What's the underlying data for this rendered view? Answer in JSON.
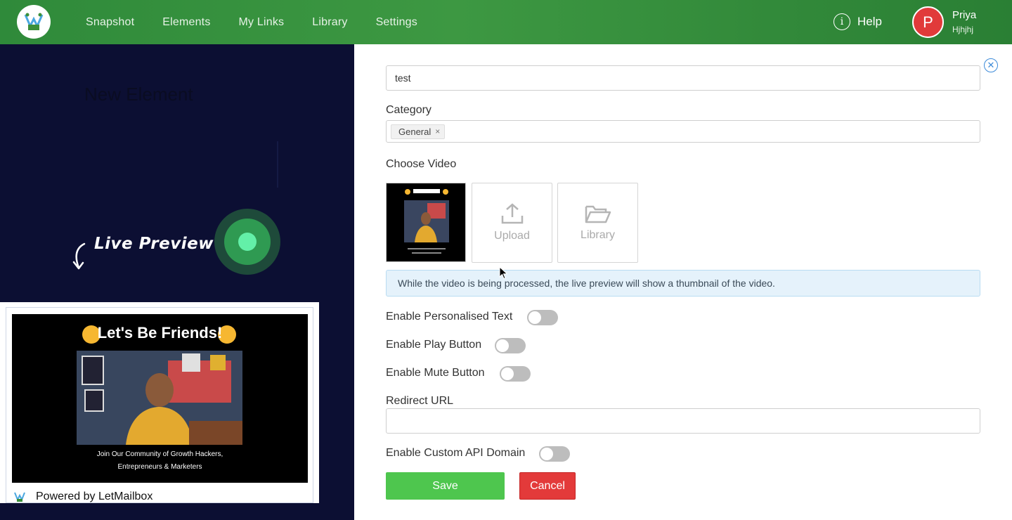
{
  "nav": {
    "items": [
      "Snapshot",
      "Elements",
      "My Links",
      "Library",
      "Settings"
    ],
    "help_label": "Help",
    "help_glyph": "i",
    "user": {
      "initial": "P",
      "name": "Priya",
      "subtitle": "Hjhjhj"
    }
  },
  "left": {
    "ghost_title": "New Element",
    "live_preview_label": "Live Preview",
    "preview": {
      "video_title": "Let's Be Friends!",
      "caption_line1": "Join Our Community of Growth Hackers,",
      "caption_line2": "Entrepreneurs & Marketers",
      "powered_by": "Powered by LetMailbox"
    }
  },
  "form": {
    "close_glyph": "✕",
    "name_value": "test",
    "category_label": "Category",
    "category_tag": "General",
    "category_tag_remove": "×",
    "choose_video_label": "Choose Video",
    "upload_label": "Upload",
    "library_label": "Library",
    "info_text": "While the video is being processed, the live preview will show a thumbnail of the video.",
    "toggles": {
      "personalised_text": {
        "label": "Enable Personalised Text",
        "enabled": false
      },
      "play_button": {
        "label": "Enable Play Button",
        "enabled": false
      },
      "mute_button": {
        "label": "Enable Mute Button",
        "enabled": false
      },
      "custom_api_domain": {
        "label": "Enable Custom API Domain",
        "enabled": false
      }
    },
    "redirect_label": "Redirect URL",
    "redirect_value": "",
    "save_label": "Save",
    "cancel_label": "Cancel"
  },
  "colors": {
    "nav_green": "#3d9842",
    "save_green": "#4ec64e",
    "cancel_red": "#e33a3a",
    "avatar_red": "#e13a3a",
    "panel_navy": "#0c0f33",
    "info_blue": "#e5f2fb"
  }
}
